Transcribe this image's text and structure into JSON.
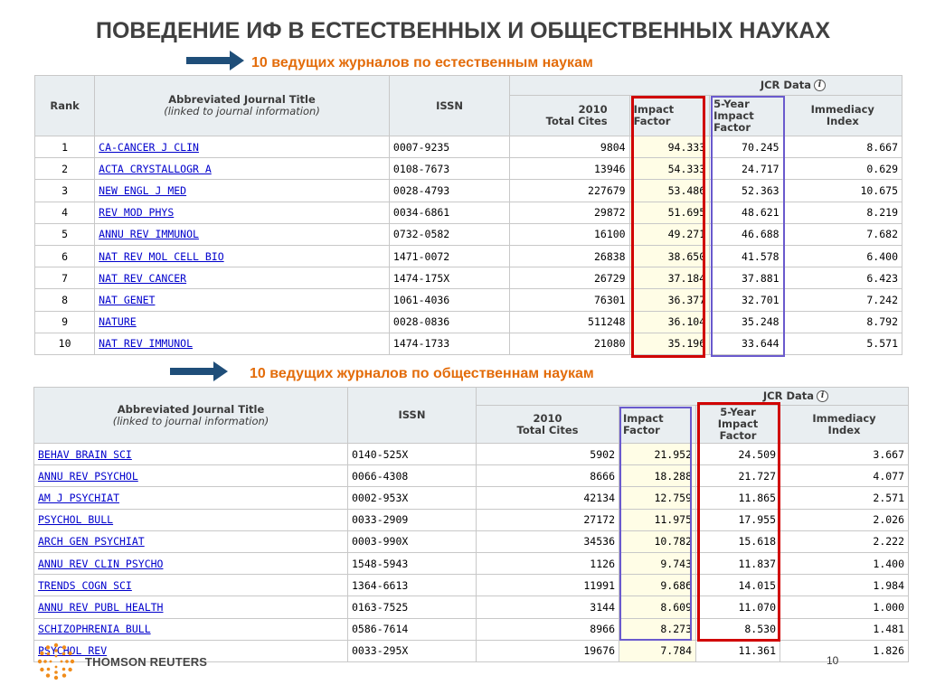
{
  "slide_title": "ПОВЕДЕНИЕ ИФ В ЕСТЕСТВЕННЫХ И ОБЩЕСТВЕННЫХ НАУКАХ",
  "subtitle_natural": "10 ведущих журналов по естественным наукам",
  "subtitle_social": "10 ведущих журналов по общественнам наукам",
  "colors": {
    "title": "#404040",
    "subtitle": "#e36c0a",
    "arrow": "#1f4e79",
    "link": "#0000cc",
    "red_box": "#d00000",
    "purple_box": "#6a5acd"
  },
  "headers": {
    "rank": "Rank",
    "title_main": "Abbreviated Journal Title",
    "title_sub": "(linked to journal information)",
    "issn": "ISSN",
    "jcr": "JCR Data",
    "cites_1": "2010",
    "cites_2": "Total Cites",
    "if_1": "Impact",
    "if_2": "Factor",
    "if5_1": "5-Year",
    "if5_2": "Impact",
    "if5_3": "Factor",
    "imm_1": "Immediacy",
    "imm_2": "Index"
  },
  "natural": [
    {
      "rank": "1",
      "title": "CA-CANCER J CLIN",
      "issn": "0007-9235",
      "cites": "9804",
      "if": "94.333",
      "if5": "70.245",
      "imm": "8.667"
    },
    {
      "rank": "2",
      "title": "ACTA CRYSTALLOGR A",
      "issn": "0108-7673",
      "cites": "13946",
      "if": "54.333",
      "if5": "24.717",
      "imm": "0.629"
    },
    {
      "rank": "3",
      "title": "NEW ENGL J MED",
      "issn": "0028-4793",
      "cites": "227679",
      "if": "53.486",
      "if5": "52.363",
      "imm": "10.675"
    },
    {
      "rank": "4",
      "title": "REV MOD PHYS",
      "issn": "0034-6861",
      "cites": "29872",
      "if": "51.695",
      "if5": "48.621",
      "imm": "8.219"
    },
    {
      "rank": "5",
      "title": "ANNU REV IMMUNOL",
      "issn": "0732-0582",
      "cites": "16100",
      "if": "49.271",
      "if5": "46.688",
      "imm": "7.682"
    },
    {
      "rank": "6",
      "title": "NAT REV MOL CELL BIO",
      "issn": "1471-0072",
      "cites": "26838",
      "if": "38.650",
      "if5": "41.578",
      "imm": "6.400"
    },
    {
      "rank": "7",
      "title": "NAT REV CANCER",
      "issn": "1474-175X",
      "cites": "26729",
      "if": "37.184",
      "if5": "37.881",
      "imm": "6.423"
    },
    {
      "rank": "8",
      "title": "NAT GENET",
      "issn": "1061-4036",
      "cites": "76301",
      "if": "36.377",
      "if5": "32.701",
      "imm": "7.242"
    },
    {
      "rank": "9",
      "title": "NATURE",
      "issn": "0028-0836",
      "cites": "511248",
      "if": "36.104",
      "if5": "35.248",
      "imm": "8.792"
    },
    {
      "rank": "10",
      "title": "NAT REV IMMUNOL",
      "issn": "1474-1733",
      "cites": "21080",
      "if": "35.196",
      "if5": "33.644",
      "imm": "5.571"
    }
  ],
  "social": [
    {
      "title": "BEHAV BRAIN SCI",
      "issn": "0140-525X",
      "cites": "5902",
      "if": "21.952",
      "if5": "24.509",
      "imm": "3.667"
    },
    {
      "title": "ANNU REV PSYCHOL",
      "issn": "0066-4308",
      "cites": "8666",
      "if": "18.288",
      "if5": "21.727",
      "imm": "4.077"
    },
    {
      "title": "AM J PSYCHIAT",
      "issn": "0002-953X",
      "cites": "42134",
      "if": "12.759",
      "if5": "11.865",
      "imm": "2.571"
    },
    {
      "title": "PSYCHOL BULL",
      "issn": "0033-2909",
      "cites": "27172",
      "if": "11.975",
      "if5": "17.955",
      "imm": "2.026"
    },
    {
      "title": "ARCH GEN PSYCHIAT",
      "issn": "0003-990X",
      "cites": "34536",
      "if": "10.782",
      "if5": "15.618",
      "imm": "2.222"
    },
    {
      "title": "ANNU REV CLIN PSYCHO",
      "issn": "1548-5943",
      "cites": "1126",
      "if": "9.743",
      "if5": "11.837",
      "imm": "1.400"
    },
    {
      "title": "TRENDS COGN SCI",
      "issn": "1364-6613",
      "cites": "11991",
      "if": "9.686",
      "if5": "14.015",
      "imm": "1.984"
    },
    {
      "title": "ANNU REV PUBL HEALTH",
      "issn": "0163-7525",
      "cites": "3144",
      "if": "8.609",
      "if5": "11.070",
      "imm": "1.000"
    },
    {
      "title": "SCHIZOPHRENIA BULL",
      "issn": "0586-7614",
      "cites": "8966",
      "if": "8.273",
      "if5": "8.530",
      "imm": "1.481"
    },
    {
      "title": "PSYCHOL REV",
      "issn": "0033-295X",
      "cites": "19676",
      "if": "7.784",
      "if5": "11.361",
      "imm": "1.826"
    }
  ],
  "footer": {
    "brand": "THOMSON REUTERS",
    "logo_icon": "thomson-reuters-logo-icon",
    "page_number": "10"
  }
}
